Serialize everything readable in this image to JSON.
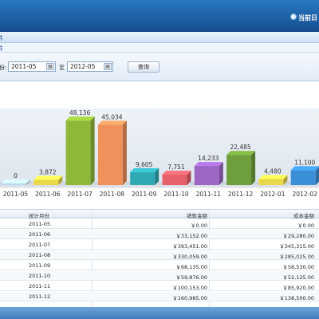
{
  "header": {
    "date_label": "当前日"
  },
  "panel": {
    "title": "件",
    "subtitle": "件"
  },
  "toolbar": {
    "from_label": "份:",
    "from_value": "2011-05",
    "to_label": "至",
    "to_value": "2012-05",
    "query_label": "查询"
  },
  "chart_data": {
    "type": "bar",
    "categories": [
      "2011-05",
      "2011-06",
      "2011-07",
      "2011-08",
      "2011-09",
      "2011-10",
      "2011-11",
      "2011-12",
      "2012-01",
      "2012-02"
    ],
    "values": [
      0,
      3872,
      48136,
      45034,
      9605,
      7751,
      14233,
      22485,
      4480,
      11100
    ],
    "value_labels": [
      "0",
      "3,872",
      "48,136",
      "45,034",
      "9,605",
      "7,751",
      "14,233",
      "22,485",
      "4,480",
      "11,100"
    ],
    "colors": [
      "#b9d8ef",
      "#e9d84a",
      "#8fb838",
      "#f0905a",
      "#2fa9b3",
      "#e5616a",
      "#9b66c4",
      "#6f9f3c",
      "#e9d84a",
      "#3a8fd6"
    ],
    "ylim": [
      0,
      50000
    ],
    "grid": false,
    "xlabel": "",
    "ylabel": ""
  },
  "table": {
    "columns": [
      "统计月份",
      "销售金额",
      "成本金额"
    ],
    "rows": [
      [
        "2011-05",
        "￥0.00",
        "￥0.00"
      ],
      [
        "2011-06",
        "￥33,152.00",
        "￥29,280.00"
      ],
      [
        "2011-07",
        "￥393,451.00",
        "￥345,315.00"
      ],
      [
        "2011-08",
        "￥330,059.00",
        "￥285,025.00"
      ],
      [
        "2011-09",
        "￥68,135.00",
        "￥58,530.00"
      ],
      [
        "2011-10",
        "￥59,876.00",
        "￥52,125.00"
      ],
      [
        "2011-11",
        "￥100,153.00",
        "￥85,920.00"
      ],
      [
        "2011-12",
        "￥160,985.00",
        "￥138,500.00"
      ]
    ]
  }
}
